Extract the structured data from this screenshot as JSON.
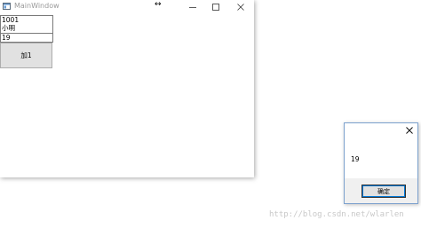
{
  "main_window": {
    "title": "MainWindow",
    "inputs": {
      "id_value": "1001",
      "name_value": "小明",
      "age_value": "19"
    },
    "add_button_label": "加1"
  },
  "message_box": {
    "message": "19",
    "ok_label": "确定"
  },
  "watermark": {
    "text": "http://blog.csdn.net/wlarlen"
  },
  "colors": {
    "window_title": "#999999",
    "button_face": "#e1e1e1",
    "msgbox_border": "#7da2ce",
    "focus_outline": "#0078d7"
  }
}
